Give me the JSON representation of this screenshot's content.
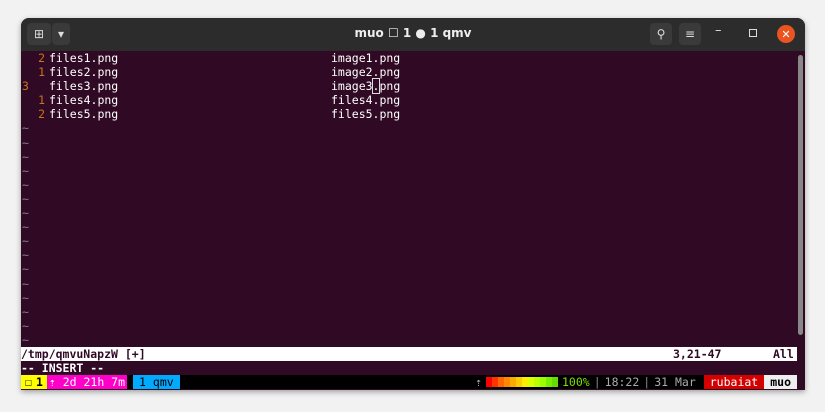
{
  "window": {
    "title": "muo ☐ 1 ● 1 qmv",
    "new_tab_icon": "terminal-add-icon",
    "dropdown_icon": "chevron-down-icon"
  },
  "lines": [
    {
      "num": "2",
      "left": "files1.png",
      "right": "image1.png"
    },
    {
      "num": "1",
      "left": "files2.png",
      "right": "image2.png"
    },
    {
      "num": "3",
      "left": "files3.png",
      "right_pre": "image3",
      "right_cursor": ".",
      "right_post": "png",
      "current": true
    },
    {
      "num": "1",
      "left": "files4.png",
      "right": "files4.png"
    },
    {
      "num": "2",
      "left": "files5.png",
      "right": "files5.png"
    }
  ],
  "tilde": "~",
  "statusline": {
    "file": "/tmp/qmvuNapzW [+]",
    "position": "3,21-47",
    "scroll": "All"
  },
  "mode": "-- INSERT --",
  "tmux": {
    "session": "1",
    "uptime": "⇡ 2d 21h 7m",
    "window": "1 qmv",
    "arrow": "⇡",
    "battery": "100%",
    "time": "18:22",
    "date": "31 Mar",
    "user": "rubaiat",
    "host": "muo",
    "sep": "|",
    "battery_fraction": 1.0
  },
  "colors": {
    "bg": "#300a24",
    "session": "#ffff00",
    "uptime": "#ff00c8",
    "window": "#00aaff",
    "user": "#d40000"
  }
}
